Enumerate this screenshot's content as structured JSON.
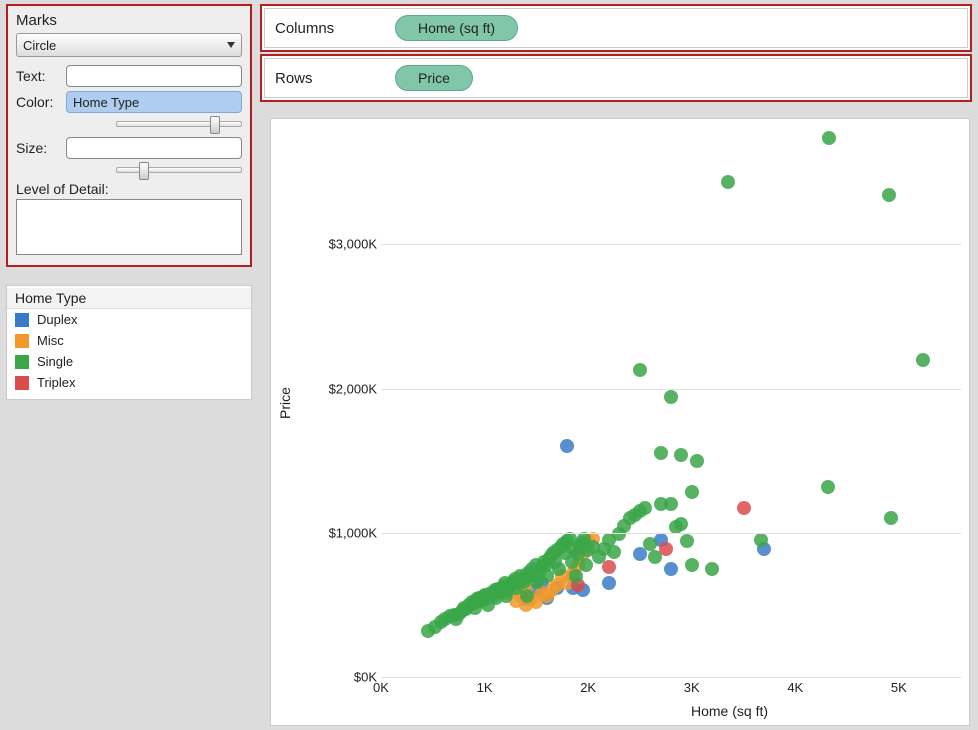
{
  "marks": {
    "title": "Marks",
    "select_value": "Circle",
    "text_label": "Text:",
    "text_value": "",
    "color_label": "Color:",
    "color_value": "Home Type",
    "size_label": "Size:",
    "size_value": "",
    "lod_label": "Level of Detail:"
  },
  "legend": {
    "title": "Home Type",
    "items": [
      {
        "label": "Duplex",
        "color": "#3a7bc7"
      },
      {
        "label": "Misc",
        "color": "#f09a2b"
      },
      {
        "label": "Single",
        "color": "#3aa648"
      },
      {
        "label": "Triplex",
        "color": "#d94c4c"
      }
    ]
  },
  "shelves": {
    "columns_label": "Columns",
    "columns_pill": "Home (sq ft)",
    "rows_label": "Rows",
    "rows_pill": "Price"
  },
  "chart_data": {
    "type": "scatter",
    "xlabel": "Home (sq ft)",
    "ylabel": "Price",
    "xlim": [
      0,
      5600
    ],
    "ylim": [
      0,
      3800
    ],
    "xticks": [
      0,
      1000,
      2000,
      3000,
      4000,
      5000
    ],
    "xtick_labels": [
      "0K",
      "1K",
      "2K",
      "3K",
      "4K",
      "5K"
    ],
    "yticks": [
      0,
      1000,
      2000,
      3000
    ],
    "ytick_labels": [
      "$0K",
      "$1,000K",
      "$2,000K",
      "$3,000K"
    ],
    "series": [
      {
        "name": "Duplex",
        "color": "#3a7bc7",
        "points": [
          [
            3700,
            890
          ],
          [
            2800,
            750
          ],
          [
            2700,
            950
          ],
          [
            2500,
            850
          ],
          [
            2200,
            650
          ],
          [
            1950,
            600
          ],
          [
            1850,
            620
          ],
          [
            1850,
            700
          ],
          [
            1800,
            1600
          ],
          [
            1700,
            620
          ],
          [
            1600,
            550
          ],
          [
            1550,
            650
          ],
          [
            1500,
            600
          ],
          [
            1400,
            540
          ]
        ]
      },
      {
        "name": "Misc",
        "color": "#f09a2b",
        "points": [
          [
            1300,
            530
          ],
          [
            1350,
            560
          ],
          [
            1400,
            500
          ],
          [
            1450,
            540
          ],
          [
            1500,
            520
          ],
          [
            1550,
            580
          ],
          [
            1600,
            560
          ],
          [
            1650,
            600
          ],
          [
            1700,
            640
          ],
          [
            1750,
            700
          ],
          [
            1800,
            650
          ],
          [
            1850,
            720
          ],
          [
            1900,
            780
          ],
          [
            1950,
            850
          ],
          [
            2000,
            940
          ],
          [
            2050,
            960
          ],
          [
            1200,
            580
          ],
          [
            1400,
            620
          ]
        ]
      },
      {
        "name": "Triplex",
        "color": "#d94c4c",
        "points": [
          [
            3500,
            1170
          ],
          [
            2750,
            890
          ],
          [
            2200,
            760
          ],
          [
            1900,
            640
          ]
        ]
      },
      {
        "name": "Single",
        "color": "#3aa648",
        "points": [
          [
            450,
            320
          ],
          [
            520,
            350
          ],
          [
            580,
            380
          ],
          [
            620,
            400
          ],
          [
            670,
            420
          ],
          [
            700,
            430
          ],
          [
            720,
            400
          ],
          [
            750,
            440
          ],
          [
            780,
            460
          ],
          [
            800,
            480
          ],
          [
            820,
            470
          ],
          [
            850,
            500
          ],
          [
            880,
            520
          ],
          [
            900,
            510
          ],
          [
            910,
            480
          ],
          [
            930,
            540
          ],
          [
            950,
            550
          ],
          [
            970,
            530
          ],
          [
            990,
            560
          ],
          [
            1000,
            570
          ],
          [
            1010,
            540
          ],
          [
            1030,
            500
          ],
          [
            1060,
            580
          ],
          [
            1080,
            560
          ],
          [
            1100,
            600
          ],
          [
            1110,
            550
          ],
          [
            1130,
            610
          ],
          [
            1150,
            590
          ],
          [
            1170,
            620
          ],
          [
            1190,
            630
          ],
          [
            1200,
            650
          ],
          [
            1210,
            560
          ],
          [
            1230,
            600
          ],
          [
            1250,
            640
          ],
          [
            1270,
            660
          ],
          [
            1290,
            680
          ],
          [
            1300,
            620
          ],
          [
            1320,
            650
          ],
          [
            1340,
            700
          ],
          [
            1360,
            680
          ],
          [
            1380,
            660
          ],
          [
            1400,
            700
          ],
          [
            1410,
            560
          ],
          [
            1420,
            720
          ],
          [
            1440,
            710
          ],
          [
            1460,
            750
          ],
          [
            1480,
            700
          ],
          [
            1500,
            780
          ],
          [
            1510,
            660
          ],
          [
            1530,
            730
          ],
          [
            1550,
            760
          ],
          [
            1570,
            800
          ],
          [
            1590,
            780
          ],
          [
            1600,
            700
          ],
          [
            1620,
            820
          ],
          [
            1640,
            840
          ],
          [
            1660,
            860
          ],
          [
            1680,
            800
          ],
          [
            1700,
            880
          ],
          [
            1720,
            750
          ],
          [
            1740,
            900
          ],
          [
            1760,
            920
          ],
          [
            1780,
            860
          ],
          [
            1800,
            940
          ],
          [
            1820,
            960
          ],
          [
            1840,
            800
          ],
          [
            1860,
            880
          ],
          [
            1880,
            700
          ],
          [
            1900,
            850
          ],
          [
            1920,
            900
          ],
          [
            1940,
            930
          ],
          [
            1960,
            960
          ],
          [
            1980,
            780
          ],
          [
            2000,
            880
          ],
          [
            2050,
            900
          ],
          [
            2100,
            830
          ],
          [
            2150,
            890
          ],
          [
            2200,
            950
          ],
          [
            2250,
            870
          ],
          [
            2300,
            990
          ],
          [
            2350,
            1050
          ],
          [
            2400,
            1100
          ],
          [
            2450,
            1120
          ],
          [
            2500,
            1150
          ],
          [
            2500,
            2130
          ],
          [
            2550,
            1170
          ],
          [
            2600,
            920
          ],
          [
            2650,
            830
          ],
          [
            2700,
            1200
          ],
          [
            2700,
            1550
          ],
          [
            2800,
            1200
          ],
          [
            2800,
            1940
          ],
          [
            2850,
            1040
          ],
          [
            2900,
            1060
          ],
          [
            2900,
            1540
          ],
          [
            2950,
            940
          ],
          [
            3000,
            1280
          ],
          [
            3000,
            780
          ],
          [
            3050,
            1500
          ],
          [
            3200,
            750
          ],
          [
            3350,
            3430
          ],
          [
            3670,
            950
          ],
          [
            4330,
            3740
          ],
          [
            4320,
            1320
          ],
          [
            4900,
            3340
          ],
          [
            4920,
            1100
          ],
          [
            5230,
            2200
          ]
        ]
      }
    ]
  }
}
